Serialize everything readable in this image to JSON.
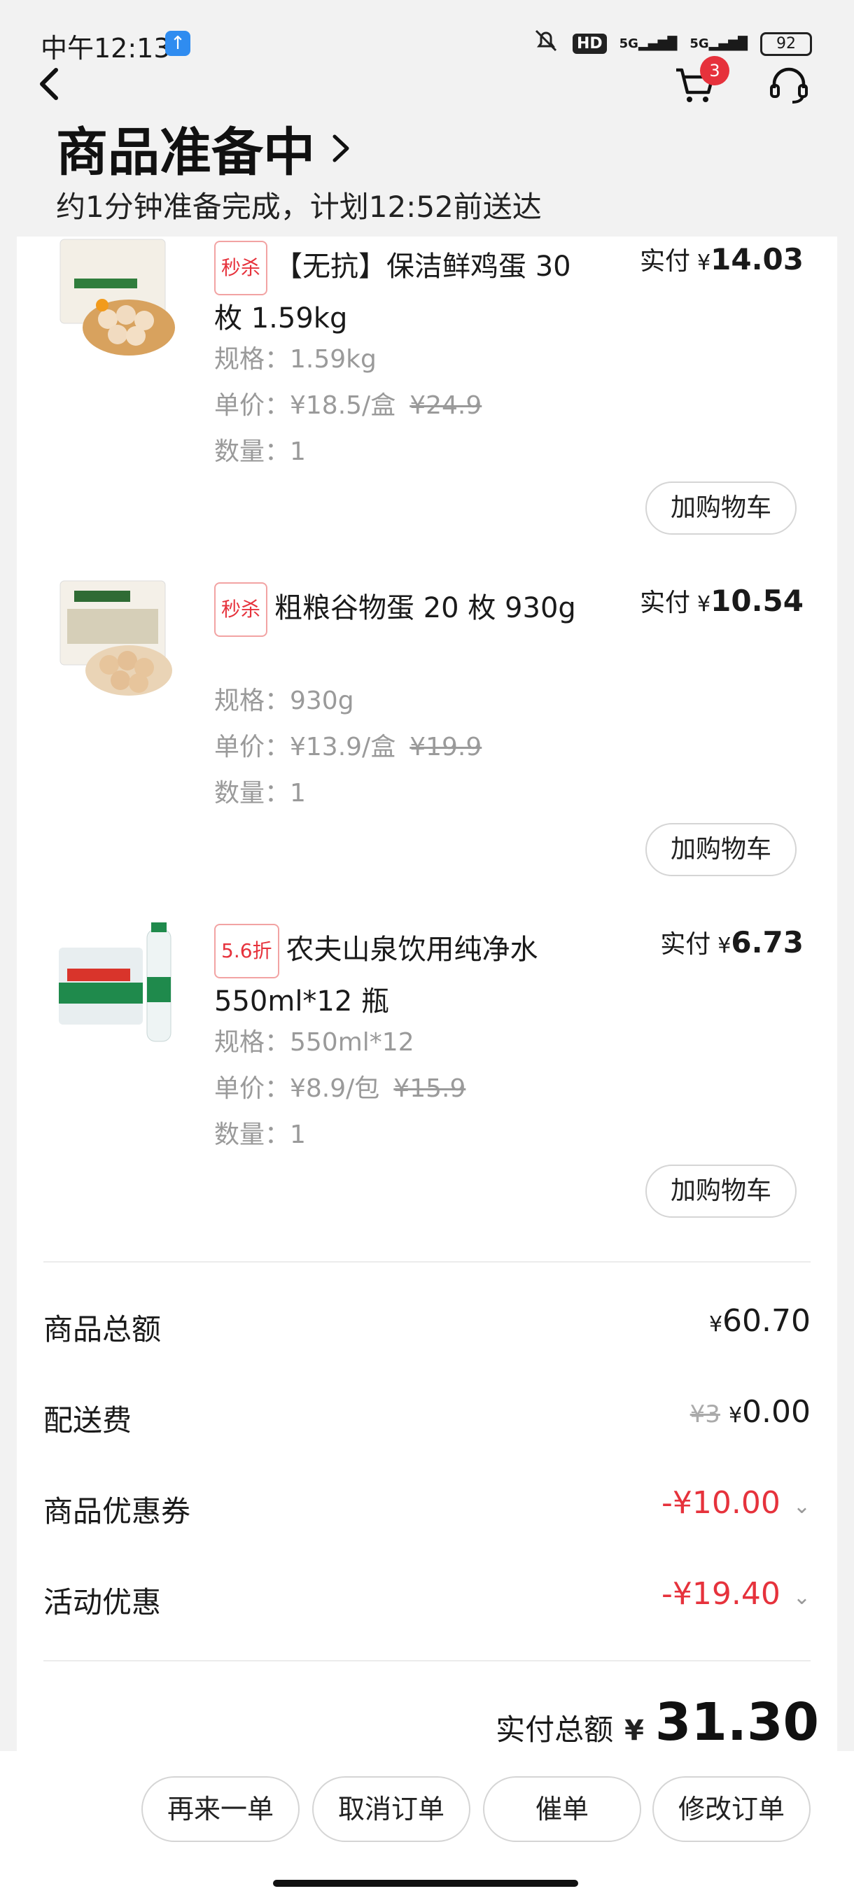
{
  "status": {
    "time": "中午12:13",
    "hd": "HD",
    "signal1": "5G",
    "signal2": "5G",
    "battery": "92"
  },
  "nav": {
    "cart_count": "3"
  },
  "header": {
    "title": "商品准备中",
    "subtitle": "约1分钟准备完成，计划12:52前送达"
  },
  "items": [
    {
      "tag": "秒杀",
      "name": "【无抗】保洁鲜鸡蛋 30 枚 1.59kg",
      "paid_label": "实付",
      "paid_yen": "¥",
      "paid_amount": "14.03",
      "spec": "规格：1.59kg",
      "unit_price": "单价：¥18.5/盒",
      "orig_price": "¥24.9",
      "qty": "数量：1",
      "add_cart": "加购物车"
    },
    {
      "tag": "秒杀",
      "name": "粗粮谷物蛋 20 枚 930g",
      "paid_label": "实付",
      "paid_yen": "¥",
      "paid_amount": "10.54",
      "spec": "规格：930g",
      "unit_price": "单价：¥13.9/盒",
      "orig_price": "¥19.9",
      "qty": "数量：1",
      "add_cart": "加购物车"
    },
    {
      "tag": "5.6折",
      "name": "农夫山泉饮用纯净水 550ml*12 瓶",
      "paid_label": "实付",
      "paid_yen": "¥",
      "paid_amount": "6.73",
      "spec": "规格：550ml*12",
      "unit_price": "单价：¥8.9/包",
      "orig_price": "¥15.9",
      "qty": "数量：1",
      "add_cart": "加购物车"
    }
  ],
  "summary": {
    "goods_total_label": "商品总额",
    "goods_total_yen": "¥",
    "goods_total": "60.70",
    "delivery_label": "配送费",
    "delivery_orig": "¥3",
    "delivery_yen": "¥",
    "delivery_fee": "0.00",
    "coupon_label": "商品优惠券",
    "coupon_value": "-¥10.00",
    "promo_label": "活动优惠",
    "promo_value": "-¥19.40",
    "total_label": "实付总额",
    "total_yen": "¥",
    "total": "31.30"
  },
  "actions": {
    "reorder": "再来一单",
    "cancel": "取消订单",
    "urge": "催单",
    "modify": "修改订单"
  },
  "colors": {
    "accent_red": "#e6323c",
    "water_green": "#1f8a4c"
  }
}
